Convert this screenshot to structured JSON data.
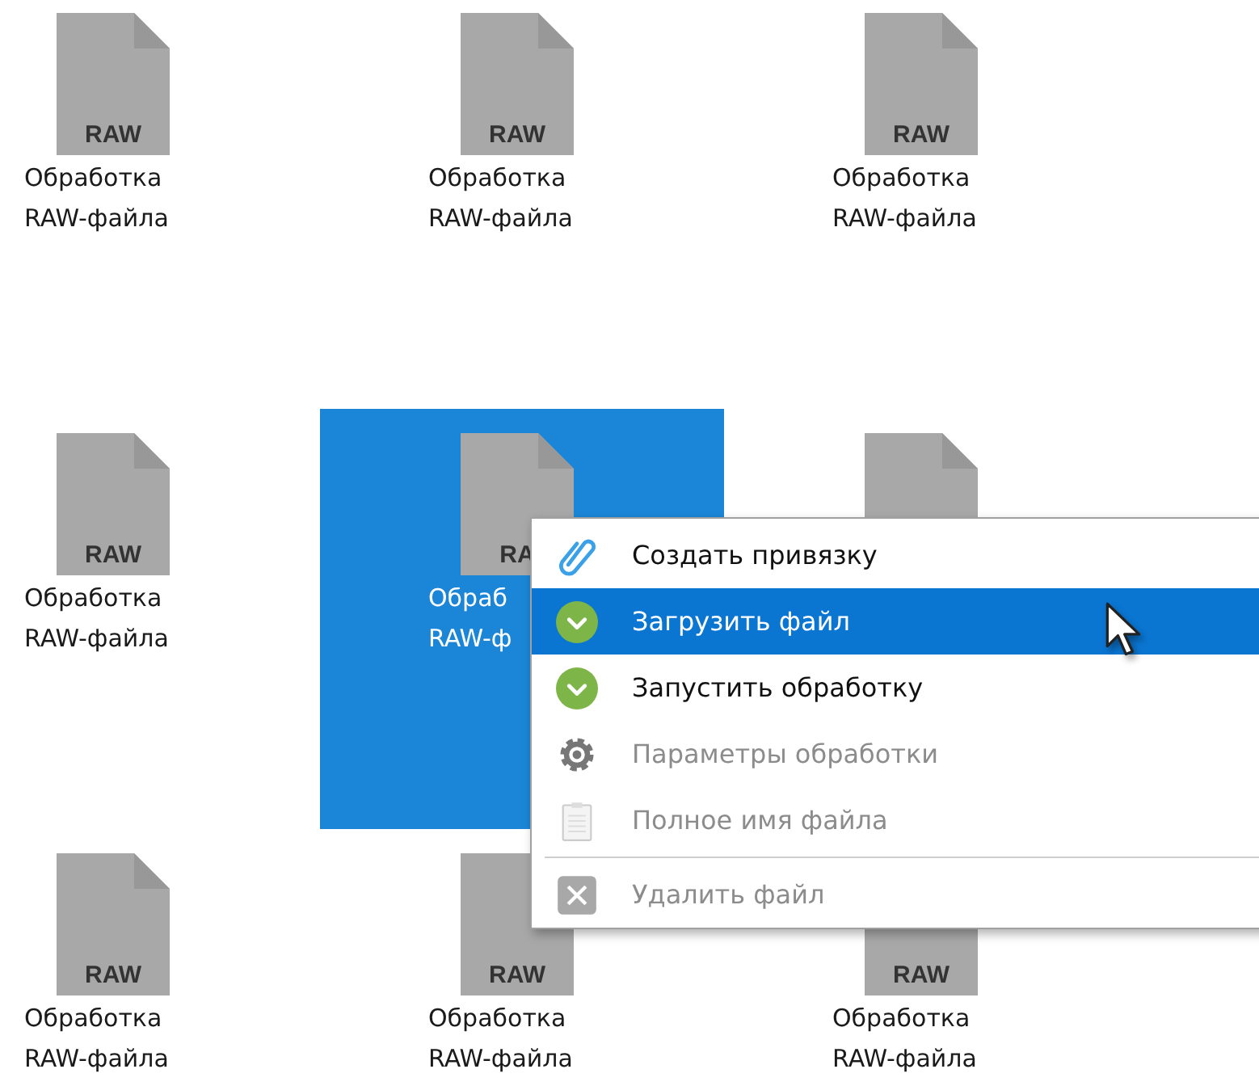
{
  "files": [
    {
      "badge": "RAW",
      "lines": [
        "Обработка",
        "RAW-файла"
      ],
      "selected": false
    },
    {
      "badge": "RAW",
      "lines": [
        "Обработка",
        "RAW-файла"
      ],
      "selected": false
    },
    {
      "badge": "RAW",
      "lines": [
        "Обработка",
        "RAW-файла"
      ],
      "selected": false
    },
    {
      "badge": "RAW",
      "lines": [
        "Обработка",
        "RAW-файла"
      ],
      "selected": false
    },
    {
      "badge": "RA",
      "lines": [
        "Обраб",
        "RAW-ф"
      ],
      "selected": true
    },
    {
      "selected": false
    },
    {
      "badge": "RAW",
      "lines": [
        "Обработка",
        "RAW-файла"
      ],
      "selected": false
    },
    {
      "badge": "RAW",
      "lines": [
        "Обработка",
        "RAW-файла"
      ],
      "selected": false
    },
    {
      "badge": "RAW",
      "lines": [
        "Обработка",
        "RAW-файла"
      ],
      "selected": false
    }
  ],
  "context_menu": {
    "groups": [
      [
        {
          "kind": "clip",
          "label": "Создать привязку",
          "selected": false,
          "disabled": false
        },
        {
          "kind": "check",
          "label": "Загрузить файл",
          "selected": true,
          "disabled": false
        },
        {
          "kind": "check",
          "label": "Запустить обработку",
          "selected": false,
          "disabled": false
        },
        {
          "kind": "gear",
          "label": "Параметры обработки",
          "selected": false,
          "disabled": true
        },
        {
          "kind": "clipboard",
          "label": "Полное имя файла",
          "selected": false,
          "disabled": true
        }
      ],
      [
        {
          "kind": "delete",
          "label": "Удалить файл",
          "selected": false,
          "disabled": true
        }
      ]
    ]
  }
}
